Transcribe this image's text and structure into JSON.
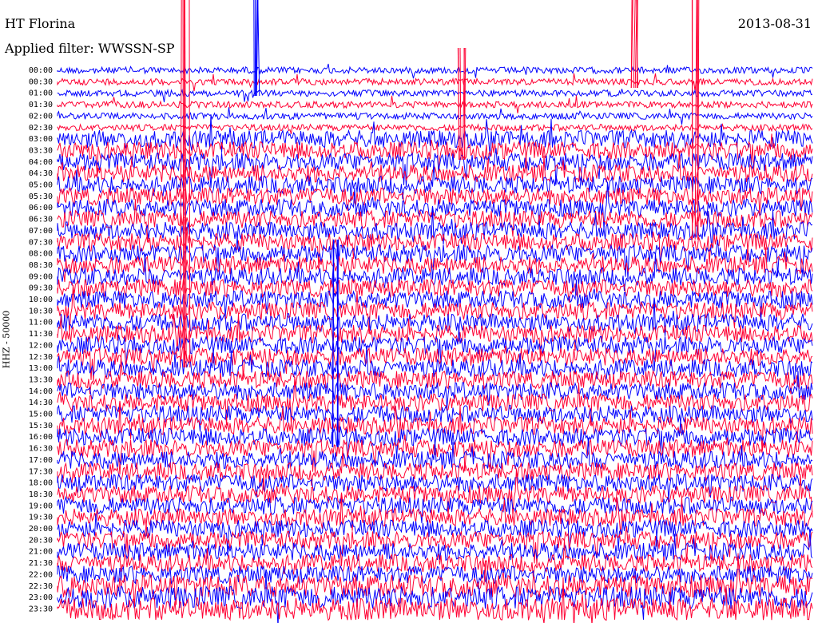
{
  "header": {
    "station": "HT Florina",
    "filter": "Applied filter: WWSSN-SP",
    "date": "2013-08-31"
  },
  "chart_data": {
    "type": "line",
    "title": "HT Florina",
    "ylabel": "HHZ - 50000",
    "colors": [
      "#0000ff",
      "#ff0033"
    ],
    "grid": false,
    "y_tick_labels": [
      "00:00",
      "00:30",
      "01:00",
      "01:30",
      "02:00",
      "02:30",
      "03:00",
      "03:30",
      "04:00",
      "04:30",
      "05:00",
      "05:30",
      "06:00",
      "06:30",
      "07:00",
      "07:30",
      "08:00",
      "08:30",
      "09:00",
      "09:30",
      "10:00",
      "10:30",
      "11:00",
      "11:30",
      "12:00",
      "12:30",
      "13:00",
      "13:30",
      "14:00",
      "14:30",
      "15:00",
      "15:30",
      "16:00",
      "16:30",
      "17:00",
      "17:30",
      "18:00",
      "18:30",
      "19:00",
      "19:30",
      "20:00",
      "20:30",
      "21:00",
      "21:30",
      "22:00",
      "22:30",
      "23:00",
      "23:30"
    ]
  }
}
